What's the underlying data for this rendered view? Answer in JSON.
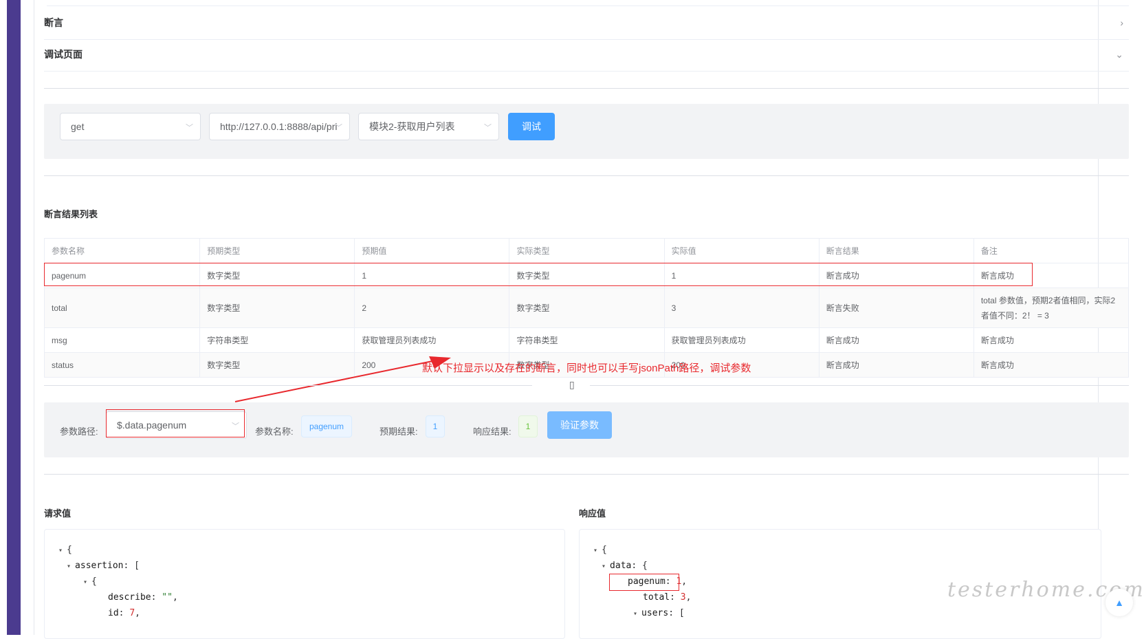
{
  "collapse": {
    "assertion_title": "断言",
    "debug_title": "调试页面",
    "chevron_right": "›",
    "chevron_down": "⌄"
  },
  "debug_bar": {
    "method": "get",
    "url": "http://127.0.0.1:8888/api/pri",
    "case": "模块2-获取用户列表",
    "debug_button": "调试"
  },
  "result_table": {
    "title": "断言结果列表",
    "columns": [
      "参数名称",
      "预期类型",
      "预期值",
      "实际类型",
      "实际值",
      "断言结果",
      "备注"
    ],
    "rows": [
      [
        "pagenum",
        "数字类型",
        "1",
        "数字类型",
        "1",
        "断言成功",
        "断言成功"
      ],
      [
        "total",
        "数字类型",
        "2",
        "数字类型",
        "3",
        "断言失败",
        "total 参数值，预期2者值相同，实际2者值不同：2！ = 3"
      ],
      [
        "msg",
        "字符串类型",
        "获取管理员列表成功",
        "字符串类型",
        "获取管理员列表成功",
        "断言成功",
        "断言成功"
      ],
      [
        "status",
        "数字类型",
        "200",
        "数字类型",
        "200",
        "断言成功",
        "断言成功"
      ]
    ]
  },
  "annotation": "默认下拉显示以及存在的断言，同时也可以手写jsonPath路径，调试参数",
  "verify_bar": {
    "path_label": "参数路径:",
    "path_value": "$.data.pagenum",
    "name_label": "参数名称:",
    "name_value": "pagenum",
    "expected_label": "预期结果:",
    "expected_value": "1",
    "response_label": "响应结果:",
    "response_value": "1",
    "verify_button": "验证参数"
  },
  "request": {
    "title": "请求值",
    "lines": [
      {
        "tri": "▾",
        "text": "{"
      },
      {
        "tri": "▾",
        "key": "assertion",
        "text": ": ["
      },
      {
        "tri": "▾",
        "text": "{"
      },
      {
        "key": "describe",
        "str": "\"\"",
        "text": ","
      },
      {
        "key": "id",
        "num": "7",
        "text": ","
      }
    ]
  },
  "response": {
    "title": "响应值",
    "lines": [
      {
        "tri": "▾",
        "text": "{"
      },
      {
        "tri": "▾",
        "key": "data",
        "text": ": {"
      },
      {
        "key": "pagenum",
        "num": "1",
        "text": ","
      },
      {
        "key": "total",
        "num": "3",
        "text": ","
      },
      {
        "tri": "▾",
        "key": "users",
        "text": ": ["
      }
    ]
  },
  "watermark": "testerhome.com",
  "icons": {
    "scroll_top": "▲",
    "divider_icon": "▯"
  }
}
